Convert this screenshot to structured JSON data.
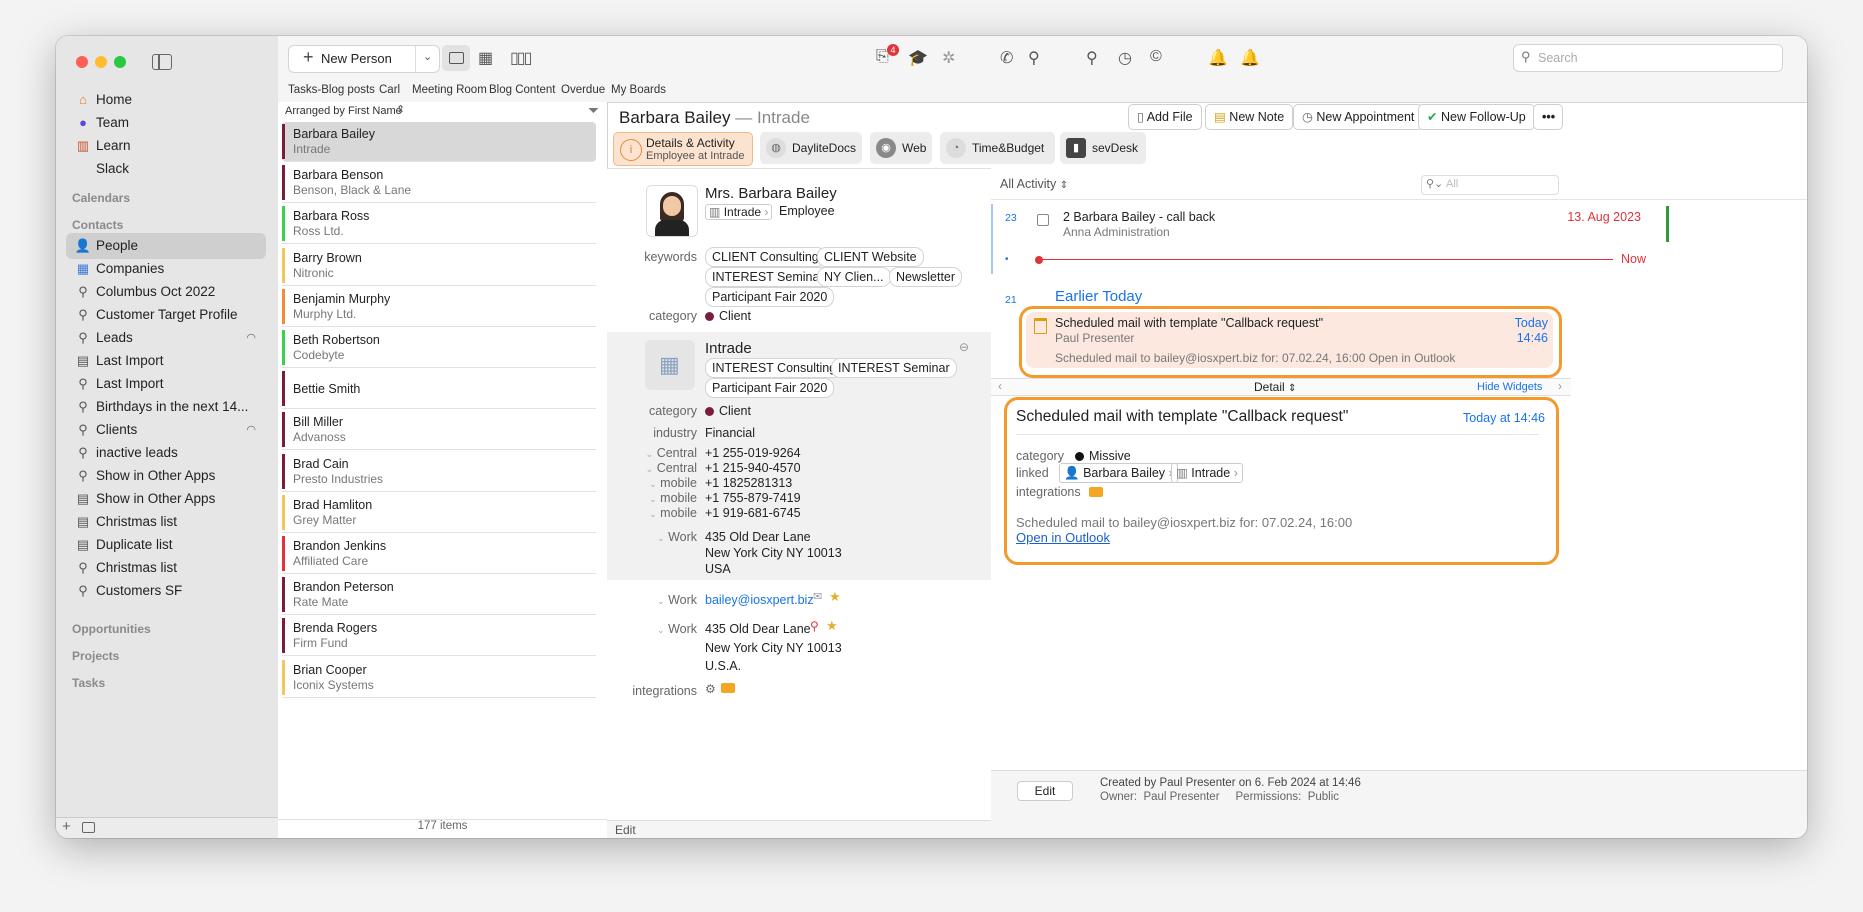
{
  "toolbar": {
    "new_person_label": "New Person",
    "search_placeholder": "Search",
    "notification_badge": "4"
  },
  "board_tabs": [
    "Tasks-Blog posts",
    "Carl",
    "Meeting Room",
    "Blog Content",
    "Overdue",
    "My Boards"
  ],
  "sidebar": {
    "nav": [
      "Home",
      "Team",
      "Learn",
      "Slack"
    ],
    "sections": [
      "Calendars",
      "Contacts",
      "Opportunities",
      "Projects",
      "Tasks"
    ],
    "contacts": [
      "People",
      "Companies",
      "Columbus Oct 2022",
      "Customer Target Profile",
      "Leads",
      "Last Import",
      "Last Import",
      "Birthdays in the next 14...",
      "Clients",
      "inactive leads",
      "Show in Other Apps",
      "Show in Other Apps",
      "Christmas list",
      "Duplicate list",
      "Christmas list",
      "Customers SF"
    ]
  },
  "list": {
    "sort_label": "Arranged by First Name",
    "footer": "177 items",
    "rows": [
      {
        "name": "Barbara Bailey",
        "company": "Intrade",
        "color": "#7a1d3d"
      },
      {
        "name": "Barbara Benson",
        "company": "Benson, Black & Lane",
        "color": "#7a1d3d"
      },
      {
        "name": "Barbara Ross",
        "company": "Ross Ltd.",
        "color": "#3bd14a"
      },
      {
        "name": "Barry Brown",
        "company": "Nitronic",
        "color": "#f0c862"
      },
      {
        "name": "Benjamin Murphy",
        "company": "Murphy Ltd.",
        "color": "#f28a3a"
      },
      {
        "name": "Beth Robertson",
        "company": "Codebyte",
        "color": "#3bd14a"
      },
      {
        "name": "Bettie Smith",
        "company": "",
        "color": "#7a1d3d"
      },
      {
        "name": "Bill Miller",
        "company": "Advanoss",
        "color": "#7a1d3d"
      },
      {
        "name": "Brad Cain",
        "company": "Presto Industries",
        "color": "#7a1d3d"
      },
      {
        "name": "Brad Hamliton",
        "company": "Grey Matter",
        "color": "#f0c862"
      },
      {
        "name": "Brandon Jenkins",
        "company": "Affiliated Care",
        "color": "#e0333a"
      },
      {
        "name": "Brandon Peterson",
        "company": "Rate Mate",
        "color": "#7a1d3d"
      },
      {
        "name": "Brenda Rogers",
        "company": "Firm Fund",
        "color": "#7a1d3d"
      },
      {
        "name": "Brian Cooper",
        "company": "Iconix Systems",
        "color": "#f0c862"
      }
    ]
  },
  "detail": {
    "name": "Barbara Bailey",
    "company_suffix": "— Intrade",
    "actions": [
      "Add File",
      "New Note",
      "New Appointment",
      "New Follow-Up"
    ],
    "tabs": [
      {
        "label": "Details & Activity",
        "sub": "Employee at Intrade"
      },
      {
        "label": "DayliteDocs",
        "sub": ""
      },
      {
        "label": "Web",
        "sub": ""
      },
      {
        "label": "Time&Budget",
        "sub": ""
      },
      {
        "label": "sevDesk",
        "sub": ""
      }
    ],
    "full_name": "Mrs. Barbara Bailey",
    "org": "Intrade",
    "role": "Employee",
    "keywords_label": "keywords",
    "keywords": [
      "CLIENT Consulting",
      "CLIENT Website",
      "INTEREST Seminar",
      "NY Clien...",
      "Newsletter",
      "Participant Fair 2020"
    ],
    "category_label": "category",
    "category": "Client",
    "company": {
      "name": "Intrade",
      "keywords": [
        "INTEREST Consulting",
        "INTEREST Seminar",
        "Participant Fair 2020"
      ],
      "category": "Client",
      "industry_label": "industry",
      "industry": "Financial",
      "phones": [
        {
          "label": "Central",
          "value": "+1 255-019-9264"
        },
        {
          "label": "Central",
          "value": "+1 215-940-4570"
        },
        {
          "label": "mobile",
          "value": "+1 1825281313"
        },
        {
          "label": "mobile",
          "value": "+1 755-879-7419"
        },
        {
          "label": "mobile",
          "value": "+1 919-681-6745"
        }
      ],
      "address_label": "Work",
      "address": [
        "435 Old Dear Lane",
        "New York City NY 10013",
        "USA"
      ]
    },
    "email_label": "Work",
    "email": "bailey@iosxpert.biz",
    "address2_label": "Work",
    "address2": [
      "435 Old Dear Lane",
      "New York City NY 10013",
      "U.S.A."
    ],
    "integrations_label": "integrations",
    "edit_label": "Edit"
  },
  "activity": {
    "filter": "All Activity",
    "search_placeholder": "All",
    "items": [
      {
        "day": "23",
        "title": "2 Barbara Bailey - call back",
        "sub": "Anna Administration",
        "date": "13. Aug 2023"
      }
    ],
    "now_label": "Now",
    "day2": "21",
    "earlier": "Earlier Today",
    "mail": {
      "title": "Scheduled mail with template \"Callback request\"",
      "from": "Paul Presenter",
      "body": "Scheduled mail to bailey@iosxpert.biz for: 07.02.24, 16:00 Open in Outlook",
      "when1": "Today",
      "when2": "14:46"
    },
    "detail_label": "Detail",
    "hide_widgets": "Hide Widgets",
    "card": {
      "title": "Scheduled mail with template \"Callback request\"",
      "when": "Today at 14:46",
      "category_label": "category",
      "category": "Missive",
      "linked_label": "linked",
      "linked_person": "Barbara Bailey",
      "linked_company": "Intrade",
      "integrations_label": "integrations",
      "body": "Scheduled mail to bailey@iosxpert.biz for: 07.02.24, 16:00",
      "link": "Open in Outlook"
    },
    "footer": {
      "edit": "Edit",
      "created": "Created by Paul Presenter on 6. Feb 2024 at 14:46",
      "owner": "Owner:  Paul Presenter     Permissions:  Public"
    }
  },
  "colors": {
    "accent": "#1a73e8",
    "highlight": "#f39a2c",
    "red": "#e0333a"
  }
}
